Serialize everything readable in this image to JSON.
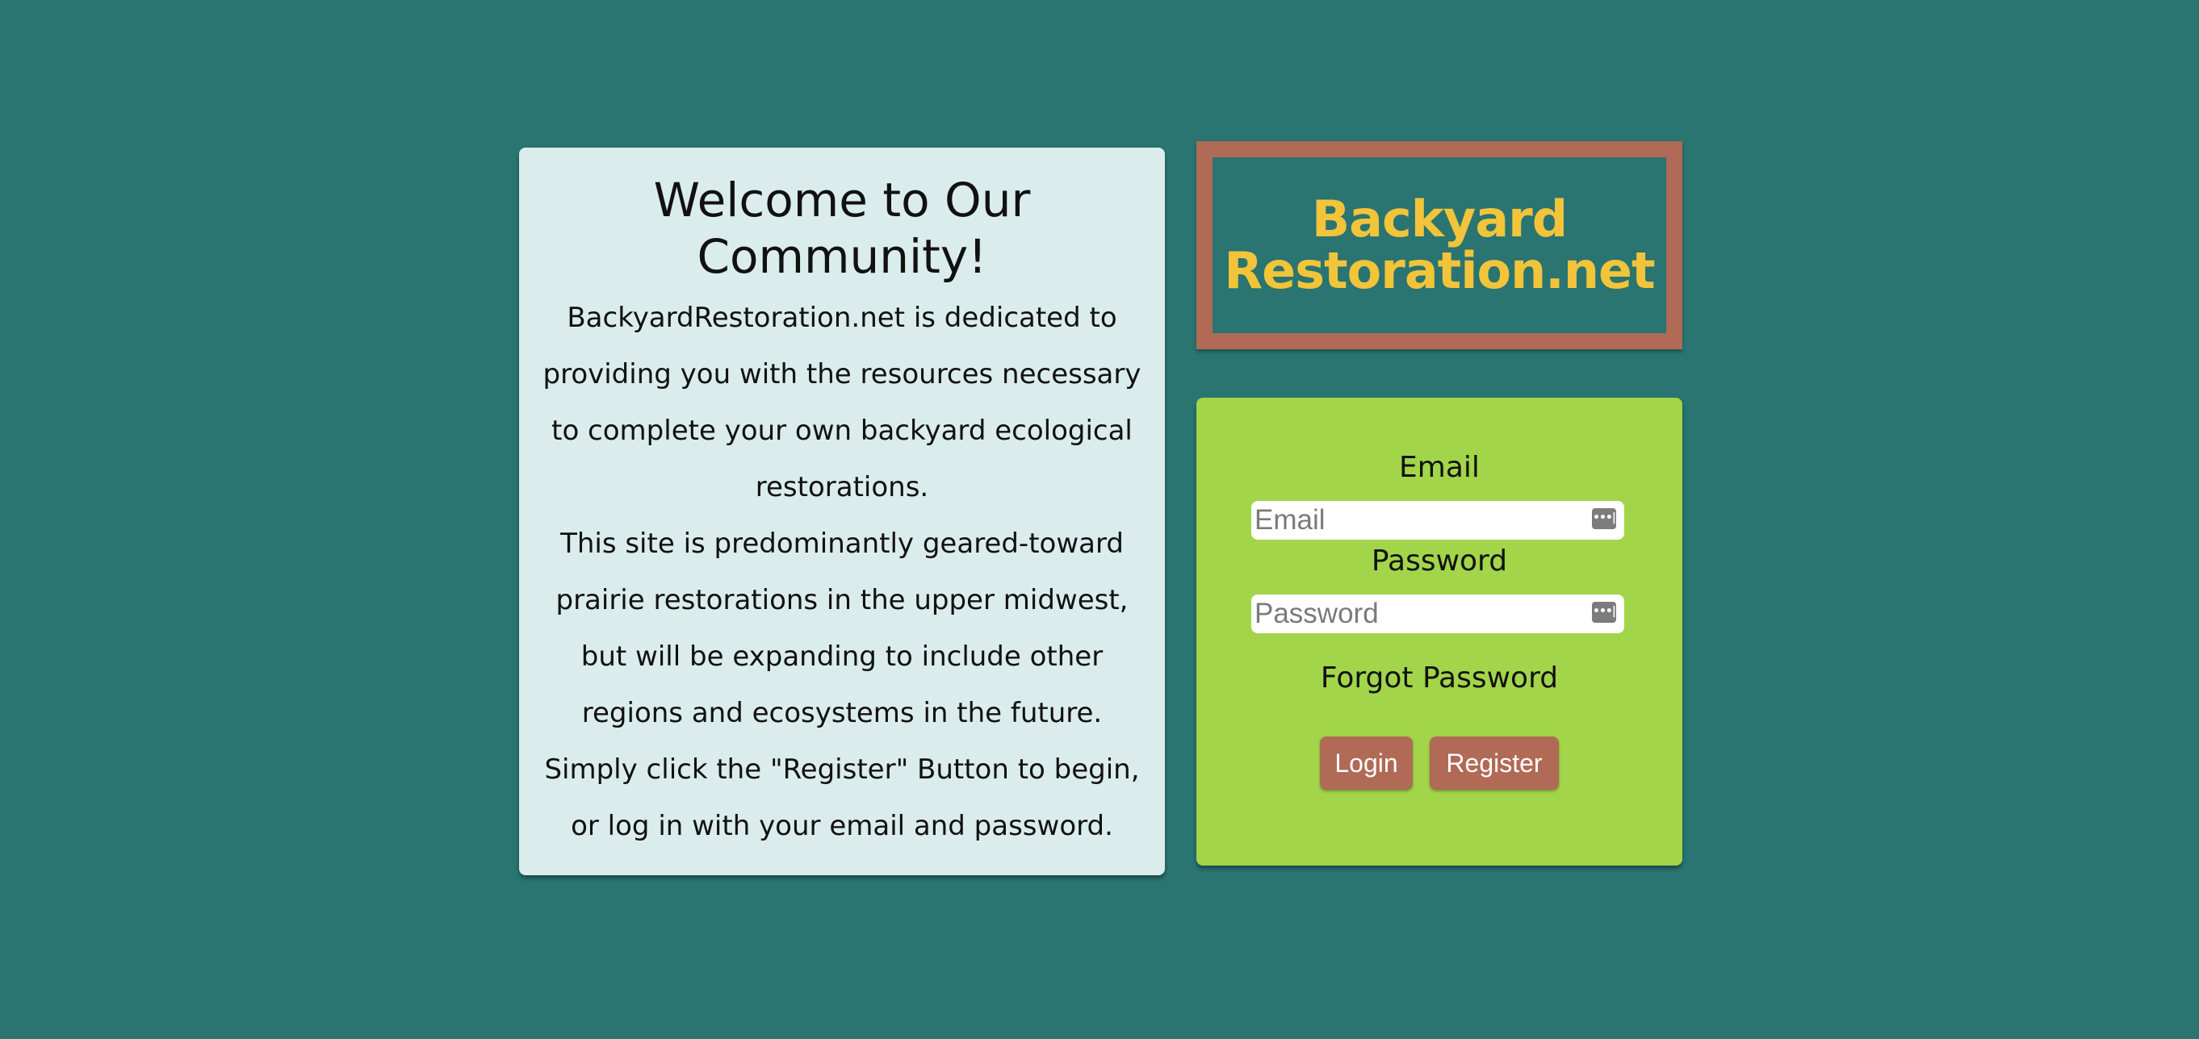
{
  "welcome": {
    "title": "Welcome to Our Community!",
    "paragraph1": "BackyardRestoration.net is dedicated to providing you with the resources necessary to complete your own backyard ecological restorations.",
    "paragraph2": "This site is predominantly geared-toward prairie restorations in the upper midwest, but will be expanding to include other regions and ecosystems in the future.",
    "paragraph3": "Simply click the \"Register\" Button to begin, or log in with your email and password."
  },
  "logo": {
    "text": "Backyard\nRestoration.net"
  },
  "login": {
    "email_label": "Email",
    "email_placeholder": "Email",
    "email_value": "",
    "password_label": "Password",
    "password_placeholder": "Password",
    "password_value": "",
    "forgot_label": "Forgot Password",
    "login_label": "Login",
    "register_label": "Register",
    "field_icon": "password-manager-key-icon",
    "field_icon_glyph": "•••|"
  },
  "colors": {
    "background": "#2a7471",
    "welcome_card": "#dbecec",
    "logo_border": "#b06a55",
    "logo_text": "#f2c43a",
    "login_card": "#a2d54a",
    "button": "#b06a55"
  }
}
